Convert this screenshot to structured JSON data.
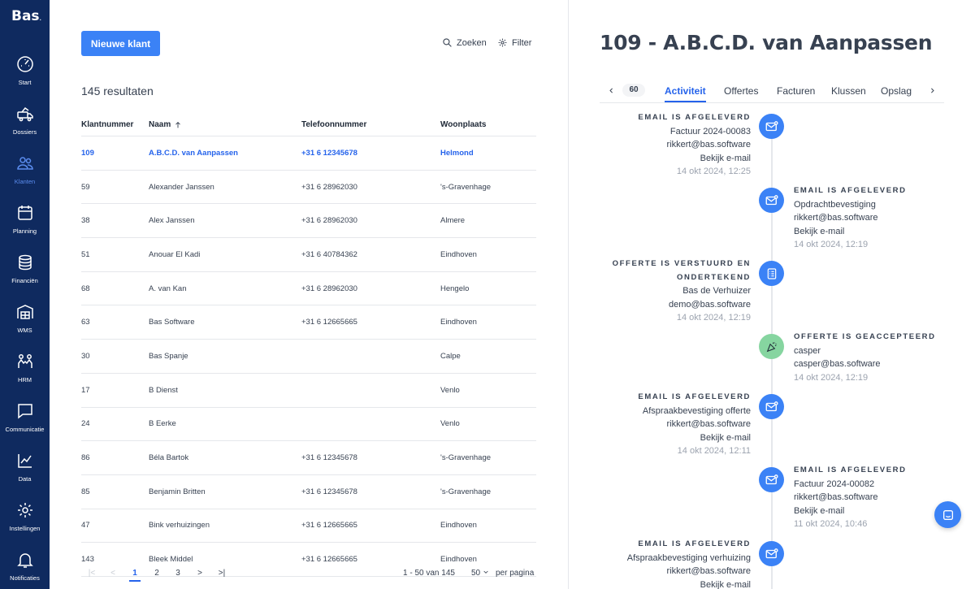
{
  "app": {
    "logo": "Bas",
    "logo_mark": "."
  },
  "sidebar": {
    "items": [
      {
        "label": "Start",
        "icon": "gauge-icon"
      },
      {
        "label": "Dossiers",
        "icon": "truck-icon"
      },
      {
        "label": "Klanten",
        "icon": "users-icon",
        "active": true
      },
      {
        "label": "Planning",
        "icon": "calendar-icon"
      },
      {
        "label": "Financiën",
        "icon": "coins-icon"
      },
      {
        "label": "WMS",
        "icon": "warehouse-icon"
      },
      {
        "label": "HRM",
        "icon": "people-icon"
      },
      {
        "label": "Communicatie",
        "icon": "chat-icon"
      },
      {
        "label": "Data",
        "icon": "line-chart-icon"
      },
      {
        "label": "Instellingen",
        "icon": "gear-icon"
      },
      {
        "label": "Notificaties",
        "icon": "bell-icon"
      }
    ]
  },
  "list": {
    "new_button": "Nieuwe klant",
    "search_label": "Zoeken",
    "filter_label": "Filter",
    "results": "145 resultaten",
    "columns": [
      "Klantnummer",
      "Naam",
      "Telefoonnummer",
      "Woonplaats"
    ],
    "rows": [
      [
        "109",
        "A.B.C.D. van Aanpassen",
        "+31 6 12345678",
        "Helmond"
      ],
      [
        "59",
        "Alexander Janssen",
        "+31 6 28962030",
        "'s-Gravenhage"
      ],
      [
        "38",
        "Alex Janssen",
        "+31 6 28962030",
        "Almere"
      ],
      [
        "51",
        "Anouar El Kadi",
        "+31 6 40784362",
        "Eindhoven"
      ],
      [
        "68",
        "A. van Kan",
        "+31 6 28962030",
        "Hengelo"
      ],
      [
        "63",
        "Bas Software",
        "+31 6 12665665",
        "Eindhoven"
      ],
      [
        "30",
        "Bas Spanje",
        "",
        "Calpe"
      ],
      [
        "17",
        "B Dienst",
        "",
        "Venlo"
      ],
      [
        "24",
        "B Eerke",
        "",
        "Venlo"
      ],
      [
        "86",
        "Béla Bartok",
        "+31 6 12345678",
        "'s-Gravenhage"
      ],
      [
        "85",
        "Benjamin Britten",
        "+31 6 12345678",
        "'s-Gravenhage"
      ],
      [
        "47",
        "Bink verhuizingen",
        "+31 6 12665665",
        "Eindhoven"
      ],
      [
        "143",
        "Bleek Middel",
        "+31 6 12665665",
        "Eindhoven"
      ]
    ],
    "pagination": {
      "first": "|<",
      "prev": "<",
      "pages": [
        "1",
        "2",
        "3"
      ],
      "next": ">",
      "last": ">|",
      "range": "1 - 50 van 145",
      "per_page_value": "50",
      "per_page_label": "per pagina"
    }
  },
  "detail": {
    "title": "109 - A.B.C.D. van Aanpassen",
    "count": "60",
    "tabs": [
      "Activiteit",
      "Offertes",
      "Facturen",
      "Klussen",
      "Opslag"
    ],
    "events": [
      {
        "title": "EMAIL IS AFGELEVERD",
        "lines": [
          "Factuur 2024-00083",
          "rikkert@bas.software"
        ],
        "link": "Bekijk e-mail",
        "time": "14 okt 2024, 12:25"
      },
      {
        "title": "EMAIL IS AFGELEVERD",
        "lines": [
          "Opdrachtbevestiging",
          "rikkert@bas.software"
        ],
        "link": "Bekijk e-mail",
        "time": "14 okt 2024, 12:19"
      },
      {
        "title_lines": [
          "OFFERTE IS VERSTUURD EN",
          "ONDERTEKEND"
        ],
        "lines": [
          "Bas de Verhuizer",
          "demo@bas.software"
        ],
        "time": "14 okt 2024, 12:19"
      },
      {
        "title": "OFFERTE IS GEACCEPTEERD",
        "lines": [
          "casper",
          "casper@bas.software"
        ],
        "time": "14 okt 2024, 12:19"
      },
      {
        "title": "EMAIL IS AFGELEVERD",
        "lines": [
          "Afspraakbevestiging offerte",
          "rikkert@bas.software"
        ],
        "link": "Bekijk e-mail",
        "time": "14 okt 2024, 12:11"
      },
      {
        "title": "EMAIL IS AFGELEVERD",
        "lines": [
          "Factuur 2024-00082",
          "rikkert@bas.software"
        ],
        "link": "Bekijk e-mail",
        "time": "11 okt 2024, 10:46"
      },
      {
        "title": "EMAIL IS AFGELEVERD",
        "lines": [
          "Afspraakbevestiging verhuizing",
          "rikkert@bas.software"
        ],
        "link": "Bekijk e-mail"
      }
    ]
  },
  "colors": {
    "sidebar": "#0f2a5f",
    "accent": "#3b82f6",
    "link": "#2563eb",
    "success": "#86d5a0"
  }
}
